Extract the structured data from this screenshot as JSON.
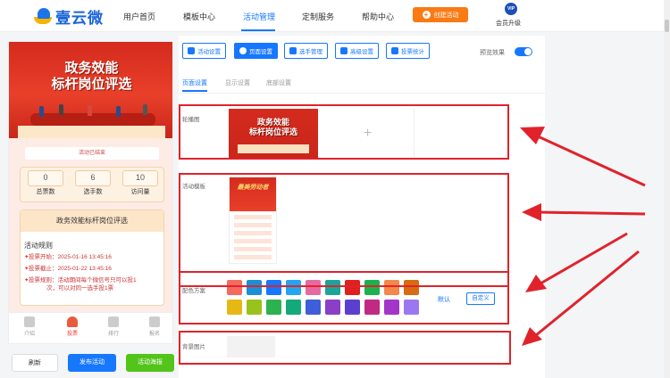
{
  "brand": {
    "name": "壹云微"
  },
  "nav": {
    "items": [
      "用户首页",
      "模板中心",
      "活动管理",
      "定制服务",
      "帮助中心"
    ],
    "create_label": "创建活动",
    "vip_badge": "VIP",
    "vip_label": "会员升级"
  },
  "preview": {
    "banner_line1": "政务效能",
    "banner_line2": "标杆岗位评选",
    "status": "活动已结束",
    "stats": [
      {
        "value": "0",
        "label": "总票数"
      },
      {
        "value": "6",
        "label": "选手数"
      },
      {
        "value": "10",
        "label": "访问量"
      }
    ],
    "rules_header": "政务效能标杆岗位评选",
    "rules_title": "活动规则",
    "rules": [
      "投票开始：2025-01-16 13:45:16",
      "投票截止：2025-01-22 13:45:16",
      "投票规则：活动期间每个微信号只可以投1",
      "次，可以对同一选手投1票"
    ],
    "tabs": [
      "介绍",
      "投票",
      "排行",
      "报名"
    ]
  },
  "actions": {
    "refresh": "刷新",
    "publish": "发布活动",
    "poster": "活动海报"
  },
  "panel": {
    "tools": [
      "活动设置",
      "页面设置",
      "选手管理",
      "高级设置",
      "投票统计"
    ],
    "preview_label": "预览效果",
    "subtabs": [
      "页面设置",
      "显示设置",
      "底部设置"
    ],
    "rows": {
      "carousel": "轮播图",
      "template": "活动模板",
      "colors": "配色方案",
      "background": "背景图片"
    },
    "carousel_thumb": {
      "line1": "政务效能",
      "line2": "标杆岗位评选"
    },
    "add_symbol": "+",
    "template_thumb_title": "最美劳动者",
    "color_default": "默认",
    "color_custom": "自定义",
    "swatches_row1": [
      "#f56a5f",
      "#1a8fd6",
      "#1677ff",
      "#23a4ef",
      "#e66aa2",
      "#1aa59a",
      "#e0201f",
      "#1bb24e",
      "#f4874b",
      "#d86a12"
    ],
    "swatches_row2": [
      "#e6b816",
      "#9ac21c",
      "#2cb24f",
      "#13a97a",
      "#3f5fd8",
      "#8a3fc6",
      "#5b3fcf",
      "#c02a82",
      "#a236c8",
      "#9c78f0"
    ]
  },
  "colors": {
    "accent": "#1677ff",
    "highlight": "#e0232b",
    "create": "#fa7a14",
    "poster": "#52c41a"
  }
}
